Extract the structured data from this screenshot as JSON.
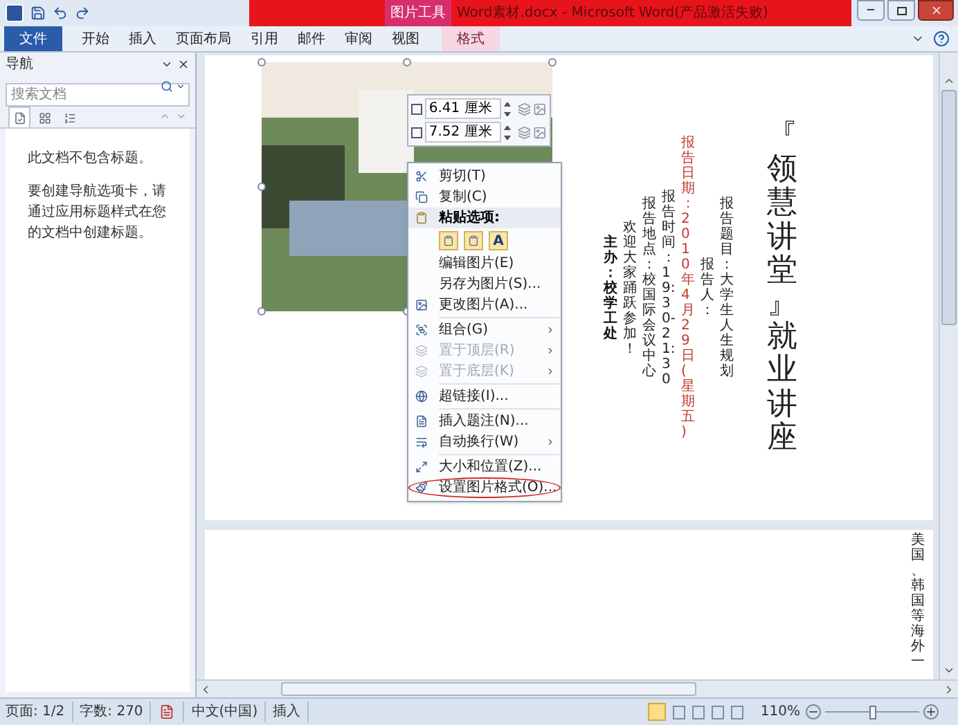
{
  "title_bar": {
    "context_group": "图片工具",
    "title": "Word素材.docx - Microsoft Word(产品激活失败)"
  },
  "ribbon_tabs": [
    {
      "label": "文件",
      "kind": "file",
      "selected": false
    },
    {
      "label": "开始",
      "kind": "tab",
      "selected": false
    },
    {
      "label": "插入",
      "kind": "tab",
      "selected": false
    },
    {
      "label": "页面布局",
      "kind": "tab",
      "selected": false
    },
    {
      "label": "引用",
      "kind": "tab",
      "selected": false
    },
    {
      "label": "邮件",
      "kind": "tab",
      "selected": false
    },
    {
      "label": "审阅",
      "kind": "tab",
      "selected": false
    },
    {
      "label": "视图",
      "kind": "tab",
      "selected": false
    },
    {
      "label": "格式",
      "kind": "context",
      "selected": false
    }
  ],
  "navigation_pane": {
    "title": "导航",
    "search_placeholder": "搜索文档",
    "view_tabs": [
      {
        "kind": "headings",
        "selected": true
      },
      {
        "kind": "pages",
        "selected": false
      },
      {
        "kind": "results",
        "selected": false
      }
    ],
    "messages": [
      "此文档不包含标题。",
      "要创建导航选项卡，请通过应用标题样式在您的文档中创建标题。"
    ]
  },
  "mini_toolbar": {
    "shape_height": "6.41 厘米",
    "shape_width": "7.52 厘米"
  },
  "context_menu": {
    "items": [
      {
        "kind": "item",
        "label": "剪切(T)",
        "disabled": false,
        "submenu": false,
        "circled": false
      },
      {
        "kind": "item",
        "label": "复制(C)",
        "disabled": false,
        "submenu": false,
        "circled": false
      },
      {
        "kind": "header",
        "label": "粘贴选项:"
      },
      {
        "kind": "paste",
        "options": [
          {
            "kind": "icon"
          },
          {
            "kind": "icon"
          },
          {
            "kind": "text",
            "label": "A"
          }
        ]
      },
      {
        "kind": "item",
        "label": "编辑图片(E)",
        "disabled": false,
        "submenu": false,
        "circled": false
      },
      {
        "kind": "item",
        "label": "另存为图片(S)...",
        "disabled": false,
        "submenu": false,
        "circled": false
      },
      {
        "kind": "item",
        "label": "更改图片(A)...",
        "disabled": false,
        "submenu": false,
        "circled": false
      },
      {
        "kind": "separator"
      },
      {
        "kind": "item",
        "label": "组合(G)",
        "disabled": false,
        "submenu": true,
        "circled": false
      },
      {
        "kind": "item",
        "label": "置于顶层(R)",
        "disabled": true,
        "submenu": true,
        "circled": false
      },
      {
        "kind": "item",
        "label": "置于底层(K)",
        "disabled": true,
        "submenu": true,
        "circled": false
      },
      {
        "kind": "separator"
      },
      {
        "kind": "item",
        "label": "超链接(I)...",
        "disabled": false,
        "submenu": false,
        "circled": false
      },
      {
        "kind": "separator"
      },
      {
        "kind": "item",
        "label": "插入题注(N)...",
        "disabled": false,
        "submenu": false,
        "circled": false
      },
      {
        "kind": "item",
        "label": "自动换行(W)",
        "disabled": false,
        "submenu": true,
        "circled": false
      },
      {
        "kind": "separator"
      },
      {
        "kind": "item",
        "label": "大小和位置(Z)...",
        "disabled": false,
        "submenu": false,
        "circled": false
      },
      {
        "kind": "item",
        "label": "设置图片格式(O)...",
        "disabled": false,
        "submenu": false,
        "circled": true
      }
    ]
  },
  "document": {
    "page_1_columns": [
      {
        "kind": "bold",
        "text": "主办：校学工处"
      },
      {
        "kind": "plain",
        "text": "欢迎大家踊跃参加！"
      },
      {
        "kind": "plain",
        "text": "报告地点：校国际会议中心"
      },
      {
        "kind": "plain",
        "text": "报告时间：19:30-21:30"
      },
      {
        "kind": "red",
        "text": "报告日期：2010年4月29日(星期五)"
      },
      {
        "kind": "plain",
        "text": "报告人："
      },
      {
        "kind": "plain",
        "text": "报告题目：大学生人生规划"
      },
      {
        "kind": "title",
        "text": "『领慧讲堂』就业讲座"
      }
    ],
    "page_2_columns": [
      {
        "kind": "plain",
        "text": "美国、韩国等海外一"
      }
    ]
  },
  "status_bar": {
    "page": "页面: 1/2",
    "words": "字数: 270",
    "language": "中文(中国)",
    "mode": "插入",
    "zoom": "110%",
    "zoom_slider": {
      "level": 0.5
    }
  }
}
